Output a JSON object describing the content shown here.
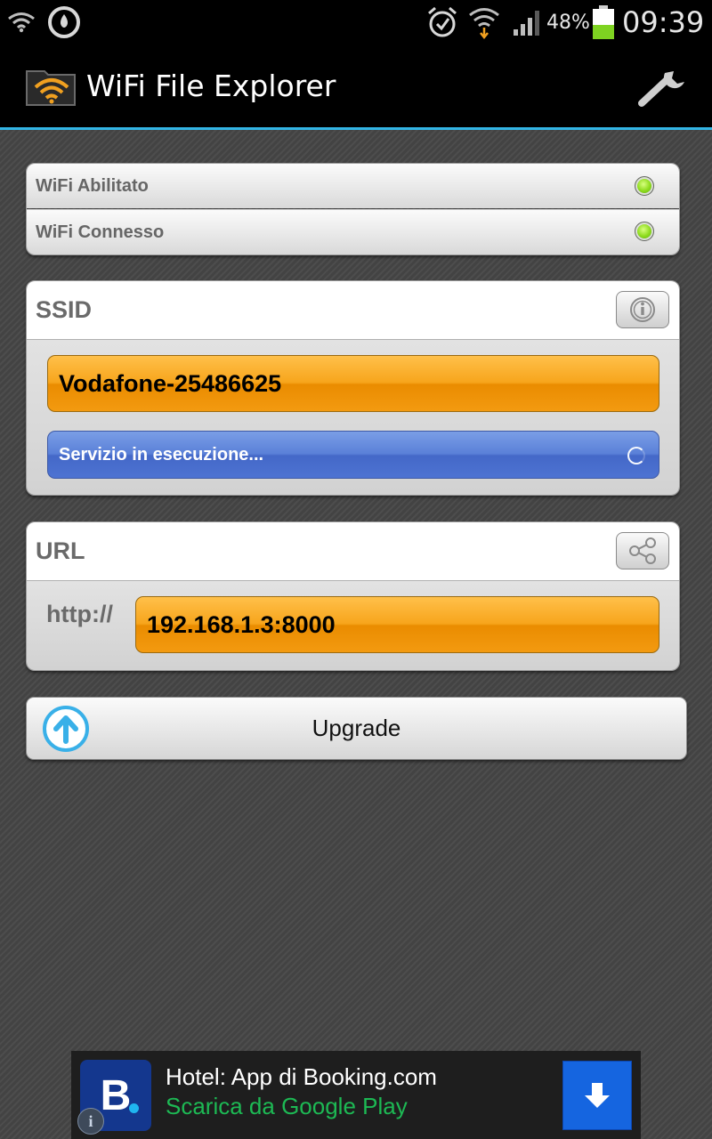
{
  "status_bar": {
    "battery_percent": "48%",
    "battery_level": 0.48,
    "time": "09:39",
    "icons": [
      "wifi-icon",
      "timer-icon",
      "alarm-icon",
      "wifi-download-icon",
      "signal-icon",
      "battery-icon"
    ]
  },
  "app_bar": {
    "title": "WiFi File Explorer",
    "icons": [
      "app-logo-icon",
      "wrench-settings-icon"
    ]
  },
  "status": {
    "wifi_enabled_label": "WiFi Abilitato",
    "wifi_connected_label": "WiFi Connesso",
    "indicator_color": "#8fdc1e"
  },
  "ssid": {
    "label": "SSID",
    "value": "Vodafone-25486625",
    "service_status": "Servizio in esecuzione..."
  },
  "url": {
    "label": "URL",
    "prefix": "http://",
    "value": "192.168.1.3:8000"
  },
  "upgrade": {
    "label": "Upgrade"
  },
  "ad": {
    "title": "Hotel: App di Booking.com",
    "subtitle": "Scarica da Google Play",
    "logo_letter": "B",
    "info_glyph": "i"
  },
  "colors": {
    "accent_line": "#33b5e5",
    "orange_field": "#f7a51c",
    "blue_field": "#5a80d8",
    "ad_subtitle": "#1db954",
    "ad_download": "#1565e0"
  }
}
